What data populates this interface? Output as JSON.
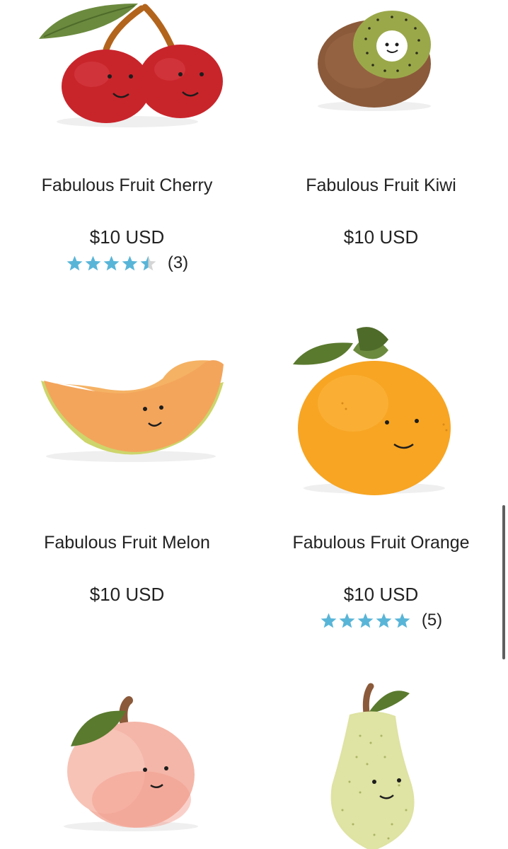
{
  "products": [
    {
      "title": "Fabulous Fruit Cherry",
      "price": "$10 USD",
      "rating": 4.5,
      "reviews": "(3)"
    },
    {
      "title": "Fabulous Fruit Kiwi",
      "price": "$10 USD"
    },
    {
      "title": "Fabulous Fruit Melon",
      "price": "$10 USD"
    },
    {
      "title": "Fabulous Fruit Orange",
      "price": "$10 USD",
      "rating": 5,
      "reviews": "(5)"
    },
    {
      "title": "",
      "price": ""
    },
    {
      "title": "",
      "price": ""
    }
  ],
  "colors": {
    "star": "#58b5d8",
    "star_empty": "#d5d5d5"
  }
}
